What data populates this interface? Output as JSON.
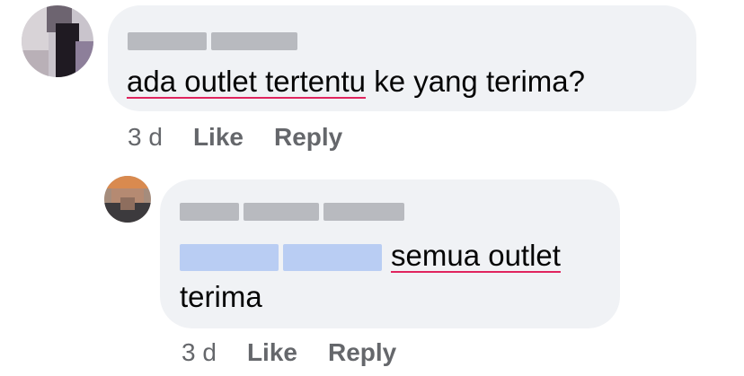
{
  "comments": [
    {
      "author_name": "",
      "text_underlined": "ada outlet tertentu",
      "text_rest": " ke yang terima?",
      "time": "3 d",
      "like_label": "Like",
      "reply_label": "Reply"
    },
    {
      "author_name": "",
      "mention": "",
      "text_underlined": "semua outlet",
      "text_line2": "terima",
      "time": "3 d",
      "like_label": "Like",
      "reply_label": "Reply"
    }
  ],
  "colors": {
    "bubble": "#f0f2f5",
    "meta_text": "#65676b",
    "underline": "#e0245e",
    "mention": "#1877f2"
  }
}
